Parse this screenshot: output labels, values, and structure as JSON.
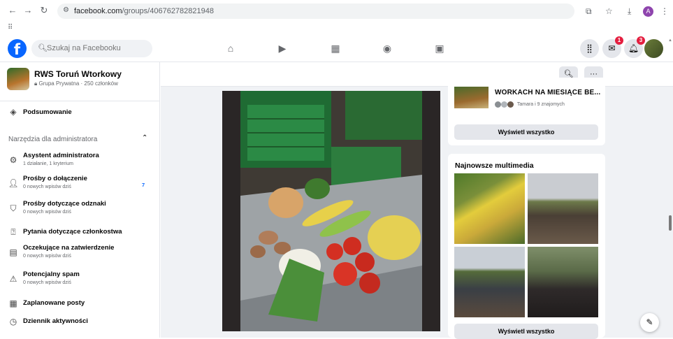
{
  "browser": {
    "url_domain": "facebook.com",
    "url_path": "/groups/406762782821948",
    "profile_letter": "A"
  },
  "header": {
    "search_placeholder": "Szukaj na Facebooku",
    "messenger_badge": "1",
    "notifications_badge": "3"
  },
  "group": {
    "name": "RWS Toruń Wtorkowy",
    "meta": "Grupa Prywatna · 250 członków"
  },
  "sidebar": {
    "summary_label": "Podsumowanie",
    "admin_section_title": "Narzędzia dla administratora",
    "items": [
      {
        "label": "Asystent administratora",
        "sub": "1 działanie, 1 kryterium",
        "icon": "gear-icon"
      },
      {
        "label": "Prośby o dołączenie",
        "sub": "0 nowych wpisów dziś",
        "icon": "person-add-icon",
        "count": "7"
      },
      {
        "label": "Prośby dotyczące odznaki",
        "sub": "0 nowych wpisów dziś",
        "icon": "badge-icon"
      },
      {
        "label": "Pytania dotyczące członkostwa",
        "sub": "",
        "icon": "question-icon"
      },
      {
        "label": "Oczekujące na zatwierdzenie",
        "sub": "0 nowych wpisów dziś",
        "icon": "pending-icon"
      },
      {
        "label": "Potencjalny spam",
        "sub": "0 nowych wpisów dziś",
        "icon": "warning-icon"
      },
      {
        "label": "Zaplanowane posty",
        "sub": "",
        "icon": "calendar-icon"
      },
      {
        "label": "Dziennik aktywności",
        "sub": "",
        "icon": "clock-icon"
      }
    ]
  },
  "right": {
    "event_title": "WORKACH NA MIESIĄCE BE...",
    "event_friends": "Tamara i 9 znajomych",
    "show_all": "Wyświetl wszystko",
    "media_title": "Najnowsze multimedia",
    "show_all_media": "Wyświetl wszystko"
  },
  "colors": {
    "brand": "#0866ff",
    "badge": "#e41e3f"
  }
}
